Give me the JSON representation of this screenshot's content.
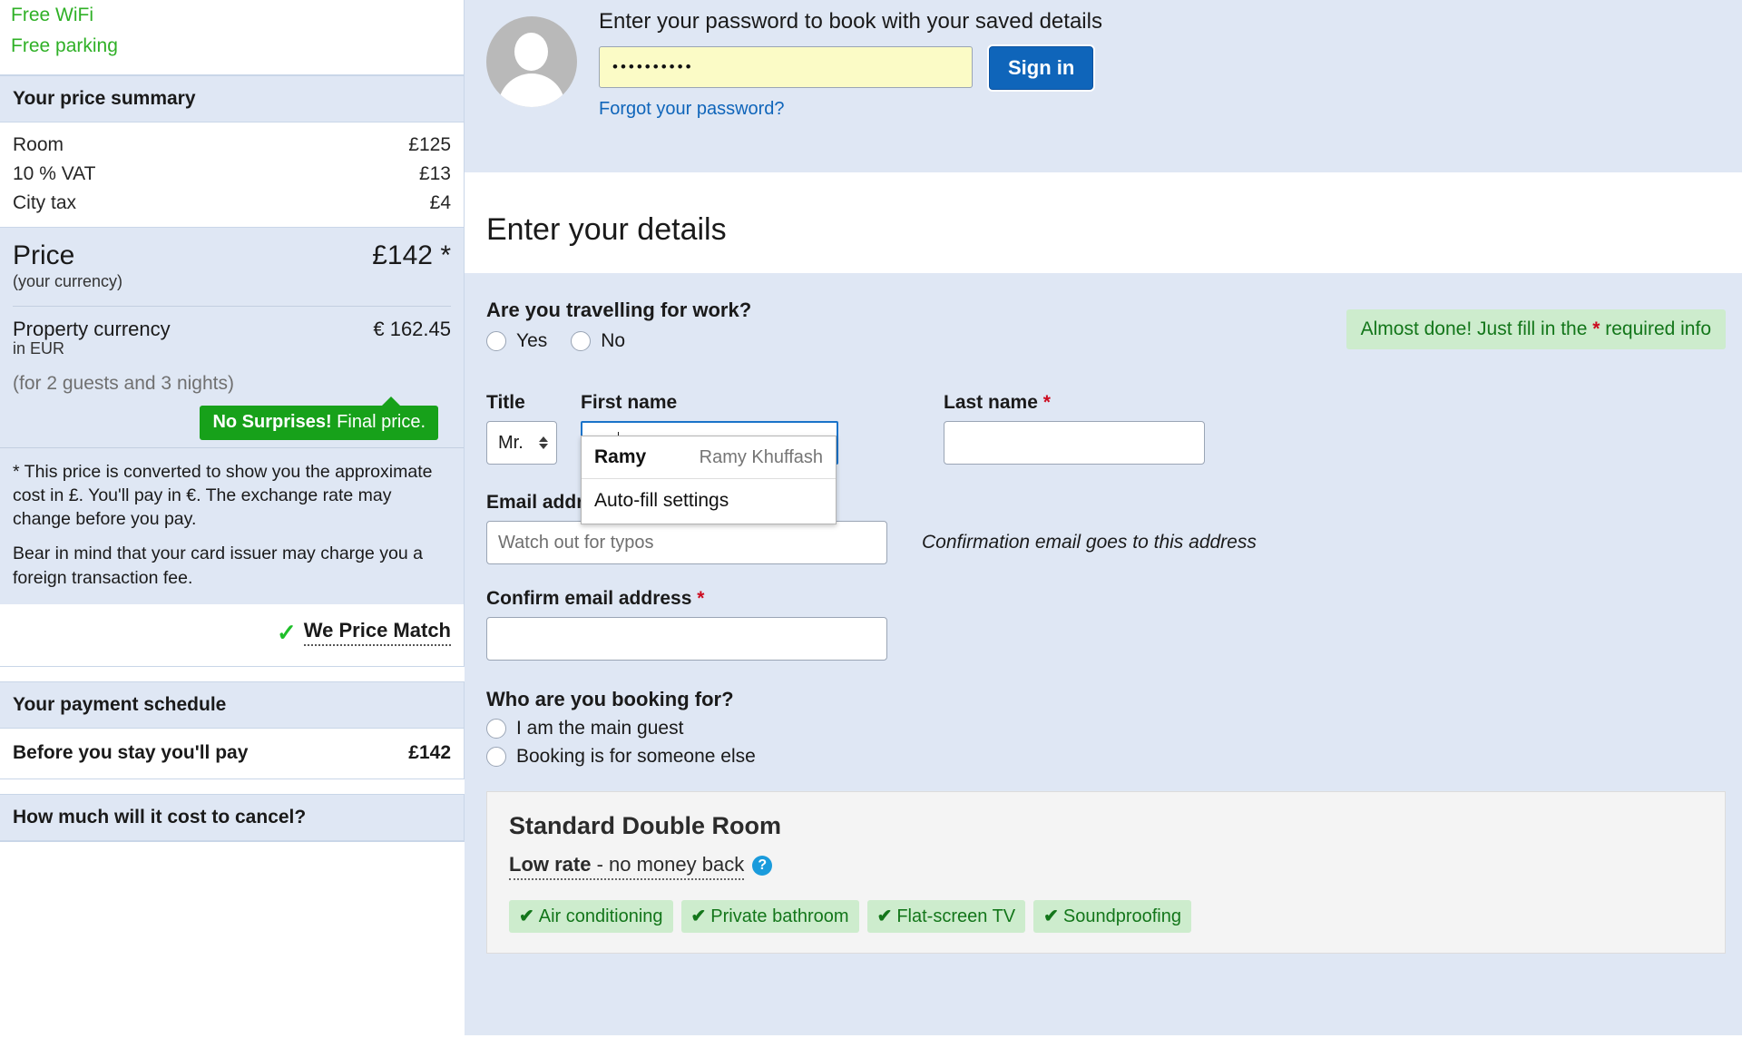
{
  "sidebar": {
    "amenities": [
      "Free WiFi",
      "Free parking"
    ],
    "price_summary": {
      "heading": "Your price summary",
      "rows": [
        {
          "label": "Room",
          "value": "£125"
        },
        {
          "label": "10 % VAT",
          "value": "£13"
        },
        {
          "label": "City tax",
          "value": "£4"
        }
      ],
      "price_label": "Price",
      "price_value": "£142 *",
      "price_sub": "(your currency)",
      "property_currency_label": "Property currency",
      "property_currency_value": "€ 162.45",
      "property_currency_sub": "in EUR",
      "guests_nights": "(for 2 guests and 3 nights)",
      "badge_bold": "No Surprises!",
      "badge_rest": " Final price.",
      "fineprint_1": "* This price is converted to show you the approximate cost in £. You'll pay in €. The exchange rate may change before you pay.",
      "fineprint_2": "Bear in mind that your card issuer may charge you a foreign transaction fee.",
      "price_match": "We Price Match"
    },
    "payment_schedule": {
      "heading": "Your payment schedule",
      "row_label": "Before you stay you'll pay",
      "row_value": "£142"
    },
    "cancel_heading": "How much will it cost to cancel?"
  },
  "signin": {
    "title": "Enter your password to book with your saved details",
    "password_value": "••••••••••",
    "button_label": "Sign in",
    "forgot_link": "Forgot your password?"
  },
  "details": {
    "heading": "Enter your details",
    "alert_pre": "Almost done! Just fill in the ",
    "alert_star": "*",
    "alert_post": " required info",
    "work_question": "Are you travelling for work?",
    "work_options": [
      "Yes",
      "No"
    ],
    "title_label": "Title",
    "title_value": "Mr.",
    "first_name_label": "First name",
    "first_name_value": "Ra",
    "last_name_label": "Last name",
    "last_name_required": "*",
    "last_name_value": "",
    "email_label": "Email address",
    "email_required": "*",
    "email_placeholder": "Watch out for typos",
    "email_note": "Confirmation email goes to this address",
    "confirm_email_label": "Confirm email address",
    "confirm_email_required": "*",
    "confirm_email_value": "",
    "booking_for_question": "Who are you booking for?",
    "booking_for_options": [
      "I am the main guest",
      "Booking is for someone else"
    ],
    "autofill": {
      "suggestion_name": "Ramy",
      "suggestion_full": "Ramy Khuffash",
      "settings_label": "Auto-fill settings"
    }
  },
  "room": {
    "name": "Standard Double Room",
    "rate_bold": "Low rate",
    "rate_rest": " - no money back",
    "help_glyph": "?",
    "amenities": [
      "Air conditioning",
      "Private bathroom",
      "Flat-screen TV",
      "Soundproofing"
    ],
    "tick": "✔"
  },
  "colors": {
    "panel_blue": "#dfe7f4",
    "accent_blue": "#0f65ba",
    "green": "#17a11a",
    "alert_green_bg": "#cdeccd",
    "alert_green_text": "#13761a",
    "required_red": "#cc0b1f",
    "password_field": "#fbfbc6"
  }
}
